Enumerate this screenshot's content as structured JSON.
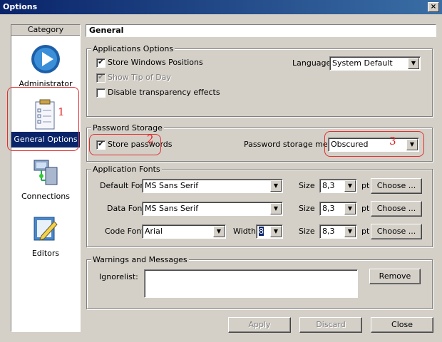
{
  "window": {
    "title": "Options",
    "close": "×"
  },
  "sidebar": {
    "header": "Category",
    "items": [
      {
        "label": "Administrator",
        "icon": "play-circle-icon"
      },
      {
        "label": "General Options",
        "icon": "checklist-icon",
        "selected": true
      },
      {
        "label": "Connections",
        "icon": "network-icon"
      },
      {
        "label": "Editors",
        "icon": "edit-pen-icon"
      }
    ]
  },
  "header": {
    "title": "General"
  },
  "applications_options": {
    "title": "Applications Options",
    "store_windows_positions": {
      "label": "Store Windows Positions",
      "checked": true
    },
    "show_tip_of_day": {
      "label": "Show Tip of Day",
      "checked": true,
      "disabled": true
    },
    "disable_transparency": {
      "label": "Disable transparency effects",
      "checked": false
    },
    "language_label": "Language:",
    "language_value": "System Default"
  },
  "password_storage": {
    "title": "Password Storage",
    "store_passwords": {
      "label": "Store passwords",
      "checked": true
    },
    "method_label": "Password storage method:",
    "method_value": "Obscured"
  },
  "application_fonts": {
    "title": "Application Fonts",
    "rows": [
      {
        "label": "Default Font:",
        "font": "MS Sans Serif",
        "size_label": "Size",
        "size": "8,3",
        "unit": "pt",
        "choose": "Choose ..."
      },
      {
        "label": "Data Font:",
        "font": "MS Sans Serif",
        "size_label": "Size",
        "size": "8,3",
        "unit": "pt",
        "choose": "Choose ..."
      },
      {
        "label": "Code Font:",
        "font": "Arial",
        "width_label": "Width:",
        "width": "8",
        "size_label": "Size",
        "size": "8,3",
        "unit": "pt",
        "choose": "Choose ..."
      }
    ]
  },
  "warnings": {
    "title": "Warnings and Messages",
    "ignorelist_label": "Ignorelist:",
    "remove": "Remove"
  },
  "footer": {
    "apply": "Apply",
    "discard": "Discard",
    "close": "Close"
  },
  "annotations": {
    "a1": "1",
    "a2": "2",
    "a3": "3"
  },
  "colors": {
    "title_bar": "#0a246a",
    "selection": "#0a246a",
    "annotation": "#e02020",
    "face": "#d4d0c8"
  }
}
